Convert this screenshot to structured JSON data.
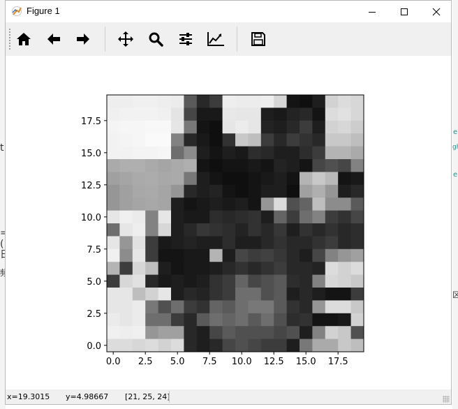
{
  "window": {
    "title": "Figure 1"
  },
  "toolbar": {
    "buttons": [
      {
        "name": "home-icon",
        "label": "Home"
      },
      {
        "name": "back-arrow-icon",
        "label": "Back"
      },
      {
        "name": "forward-arrow-icon",
        "label": "Forward"
      },
      {
        "name": "pan-move-icon",
        "label": "Pan"
      },
      {
        "name": "zoom-magnifier-icon",
        "label": "Zoom"
      },
      {
        "name": "configure-subplots-icon",
        "label": "Subplots"
      },
      {
        "name": "edit-axis-icon",
        "label": "Customize"
      },
      {
        "name": "save-floppy-icon",
        "label": "Save"
      }
    ]
  },
  "status": {
    "x": "x=19.3015",
    "y": "y=4.98667",
    "pixel": "[21, 25, 24]"
  },
  "background_fragments": {
    "left_chars": [
      "t",
      "=(",
      "日",
      "頻"
    ],
    "right_chars": [
      "e",
      "gh",
      "e",
      "区"
    ]
  },
  "chart_data": {
    "type": "heatmap",
    "colormap": "gray",
    "vmin": 0,
    "vmax": 255,
    "xlim": [
      -0.5,
      19.5
    ],
    "ylim": [
      19.5,
      -0.5
    ],
    "xticks": [
      0.0,
      2.5,
      5.0,
      7.5,
      10.0,
      12.5,
      15.0,
      17.5
    ],
    "yticks": [
      0.0,
      2.5,
      5.0,
      7.5,
      10.0,
      12.5,
      15.0,
      17.5
    ],
    "xtick_labels": [
      "0.0",
      "2.5",
      "5.0",
      "7.5",
      "10.0",
      "12.5",
      "15.0",
      "17.5"
    ],
    "ytick_labels": [
      "0.0",
      "2.5",
      "5.0",
      "7.5",
      "10.0",
      "12.5",
      "15.0",
      "17.5"
    ],
    "rows": [
      [
        238,
        238,
        240,
        240,
        238,
        236,
        90,
        40,
        60,
        238,
        236,
        236,
        238,
        215,
        20,
        15,
        30,
        210,
        220,
        215
      ],
      [
        240,
        242,
        242,
        242,
        240,
        228,
        70,
        25,
        25,
        232,
        230,
        230,
        30,
        25,
        35,
        40,
        20,
        220,
        225,
        215
      ],
      [
        244,
        246,
        246,
        248,
        248,
        230,
        120,
        20,
        15,
        230,
        236,
        230,
        35,
        30,
        40,
        60,
        30,
        210,
        215,
        205
      ],
      [
        242,
        244,
        246,
        250,
        250,
        130,
        40,
        25,
        15,
        50,
        200,
        190,
        60,
        40,
        60,
        50,
        40,
        200,
        200,
        190
      ],
      [
        242,
        242,
        244,
        244,
        246,
        110,
        140,
        30,
        20,
        30,
        25,
        45,
        40,
        30,
        30,
        45,
        60,
        180,
        180,
        170
      ],
      [
        170,
        175,
        175,
        170,
        165,
        170,
        175,
        20,
        15,
        20,
        20,
        25,
        20,
        35,
        30,
        20,
        70,
        80,
        70,
        130
      ],
      [
        160,
        165,
        170,
        172,
        168,
        170,
        120,
        30,
        20,
        15,
        15,
        20,
        25,
        30,
        20,
        180,
        200,
        185,
        20,
        25
      ],
      [
        150,
        160,
        168,
        170,
        165,
        150,
        40,
        30,
        35,
        20,
        15,
        20,
        30,
        30,
        15,
        160,
        175,
        150,
        30,
        40
      ],
      [
        150,
        160,
        165,
        168,
        165,
        30,
        20,
        25,
        30,
        25,
        30,
        20,
        150,
        220,
        80,
        100,
        190,
        140,
        140,
        90
      ],
      [
        230,
        240,
        235,
        130,
        230,
        30,
        25,
        25,
        45,
        40,
        45,
        50,
        30,
        100,
        60,
        110,
        130,
        60,
        50,
        70
      ],
      [
        110,
        230,
        238,
        130,
        215,
        30,
        40,
        55,
        50,
        45,
        35,
        50,
        40,
        55,
        30,
        50,
        40,
        50,
        40,
        45
      ],
      [
        230,
        150,
        225,
        60,
        25,
        30,
        35,
        30,
        30,
        45,
        30,
        30,
        40,
        50,
        40,
        40,
        50,
        60,
        40,
        45
      ],
      [
        240,
        140,
        230,
        60,
        20,
        20,
        25,
        25,
        180,
        30,
        70,
        60,
        65,
        55,
        40,
        30,
        70,
        130,
        150,
        160
      ],
      [
        180,
        60,
        215,
        190,
        30,
        20,
        25,
        25,
        30,
        40,
        50,
        40,
        50,
        60,
        40,
        40,
        35,
        220,
        210,
        220
      ],
      [
        60,
        215,
        225,
        40,
        25,
        30,
        25,
        30,
        50,
        60,
        100,
        70,
        80,
        90,
        45,
        40,
        130,
        215,
        210,
        200
      ],
      [
        230,
        230,
        190,
        210,
        230,
        30,
        40,
        35,
        50,
        60,
        110,
        110,
        80,
        90,
        30,
        40,
        30,
        20,
        20,
        60
      ],
      [
        230,
        230,
        235,
        120,
        80,
        110,
        60,
        50,
        100,
        90,
        110,
        120,
        120,
        90,
        50,
        40,
        150,
        220,
        220,
        200
      ],
      [
        235,
        230,
        235,
        110,
        110,
        60,
        40,
        90,
        110,
        100,
        110,
        90,
        110,
        80,
        45,
        50,
        20,
        20,
        25,
        210
      ],
      [
        240,
        238,
        240,
        150,
        160,
        160,
        40,
        30,
        70,
        90,
        80,
        80,
        80,
        70,
        80,
        30,
        130,
        210,
        200,
        80
      ],
      [
        220,
        220,
        215,
        220,
        210,
        220,
        40,
        30,
        40,
        70,
        80,
        70,
        60,
        60,
        30,
        120,
        170,
        170,
        200,
        190
      ]
    ]
  }
}
